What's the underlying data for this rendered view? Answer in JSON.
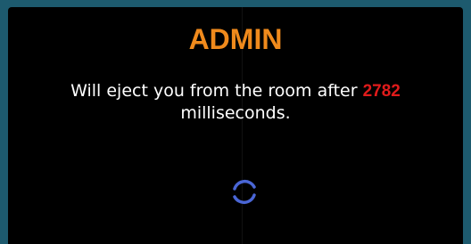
{
  "dialog": {
    "title": "ADMIN",
    "message_prefix": "Will eject you from the room after ",
    "countdown_ms": "2782",
    "message_suffix": "milliseconds.",
    "colors": {
      "background": "#000000",
      "frame": "#1d5a6e",
      "title": "#f08a1c",
      "countdown": "#e01b1b",
      "text": "#ffffff",
      "spinner": "#4a66d6"
    },
    "spinner_icon": "loading-spinner-icon"
  }
}
